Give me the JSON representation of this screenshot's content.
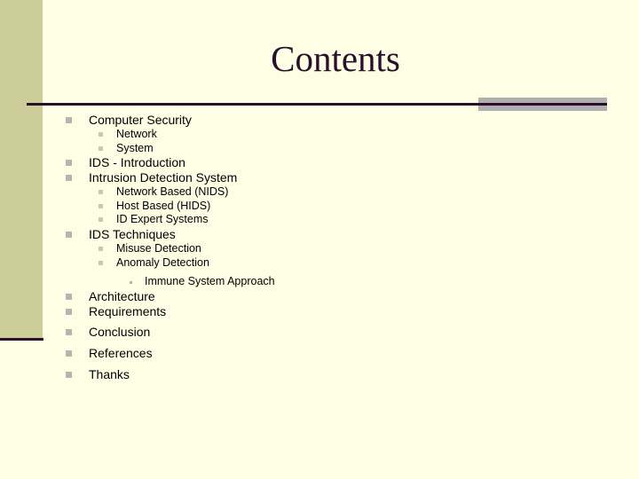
{
  "slide": {
    "title": "Contents",
    "items": [
      {
        "label": "Computer Security",
        "level": 1
      },
      {
        "label": "Network",
        "level": 2
      },
      {
        "label": "System",
        "level": 2
      },
      {
        "label": "IDS - Introduction",
        "level": 1
      },
      {
        "label": "Intrusion Detection System",
        "level": 1
      },
      {
        "label": "Network Based (NIDS)",
        "level": 2
      },
      {
        "label": "Host Based (HIDS)",
        "level": 2
      },
      {
        "label": "ID Expert Systems",
        "level": 2
      },
      {
        "label": "IDS Techniques",
        "level": 1
      },
      {
        "label": "Misuse Detection",
        "level": 2
      },
      {
        "label": "Anomaly Detection",
        "level": 2
      },
      {
        "label": "Immune System Approach",
        "level": 3
      },
      {
        "label": "Architecture",
        "level": 1
      },
      {
        "label": "Requirements",
        "level": 1
      },
      {
        "label": "Conclusion",
        "level": 1
      },
      {
        "label": "References",
        "level": 1
      },
      {
        "label": "Thanks",
        "level": 1
      }
    ]
  },
  "colors": {
    "background": "#ffffe6",
    "sidebar": "#cccc99",
    "accent_dark": "#2a0f2a",
    "accent_band": "#b0aeae"
  }
}
